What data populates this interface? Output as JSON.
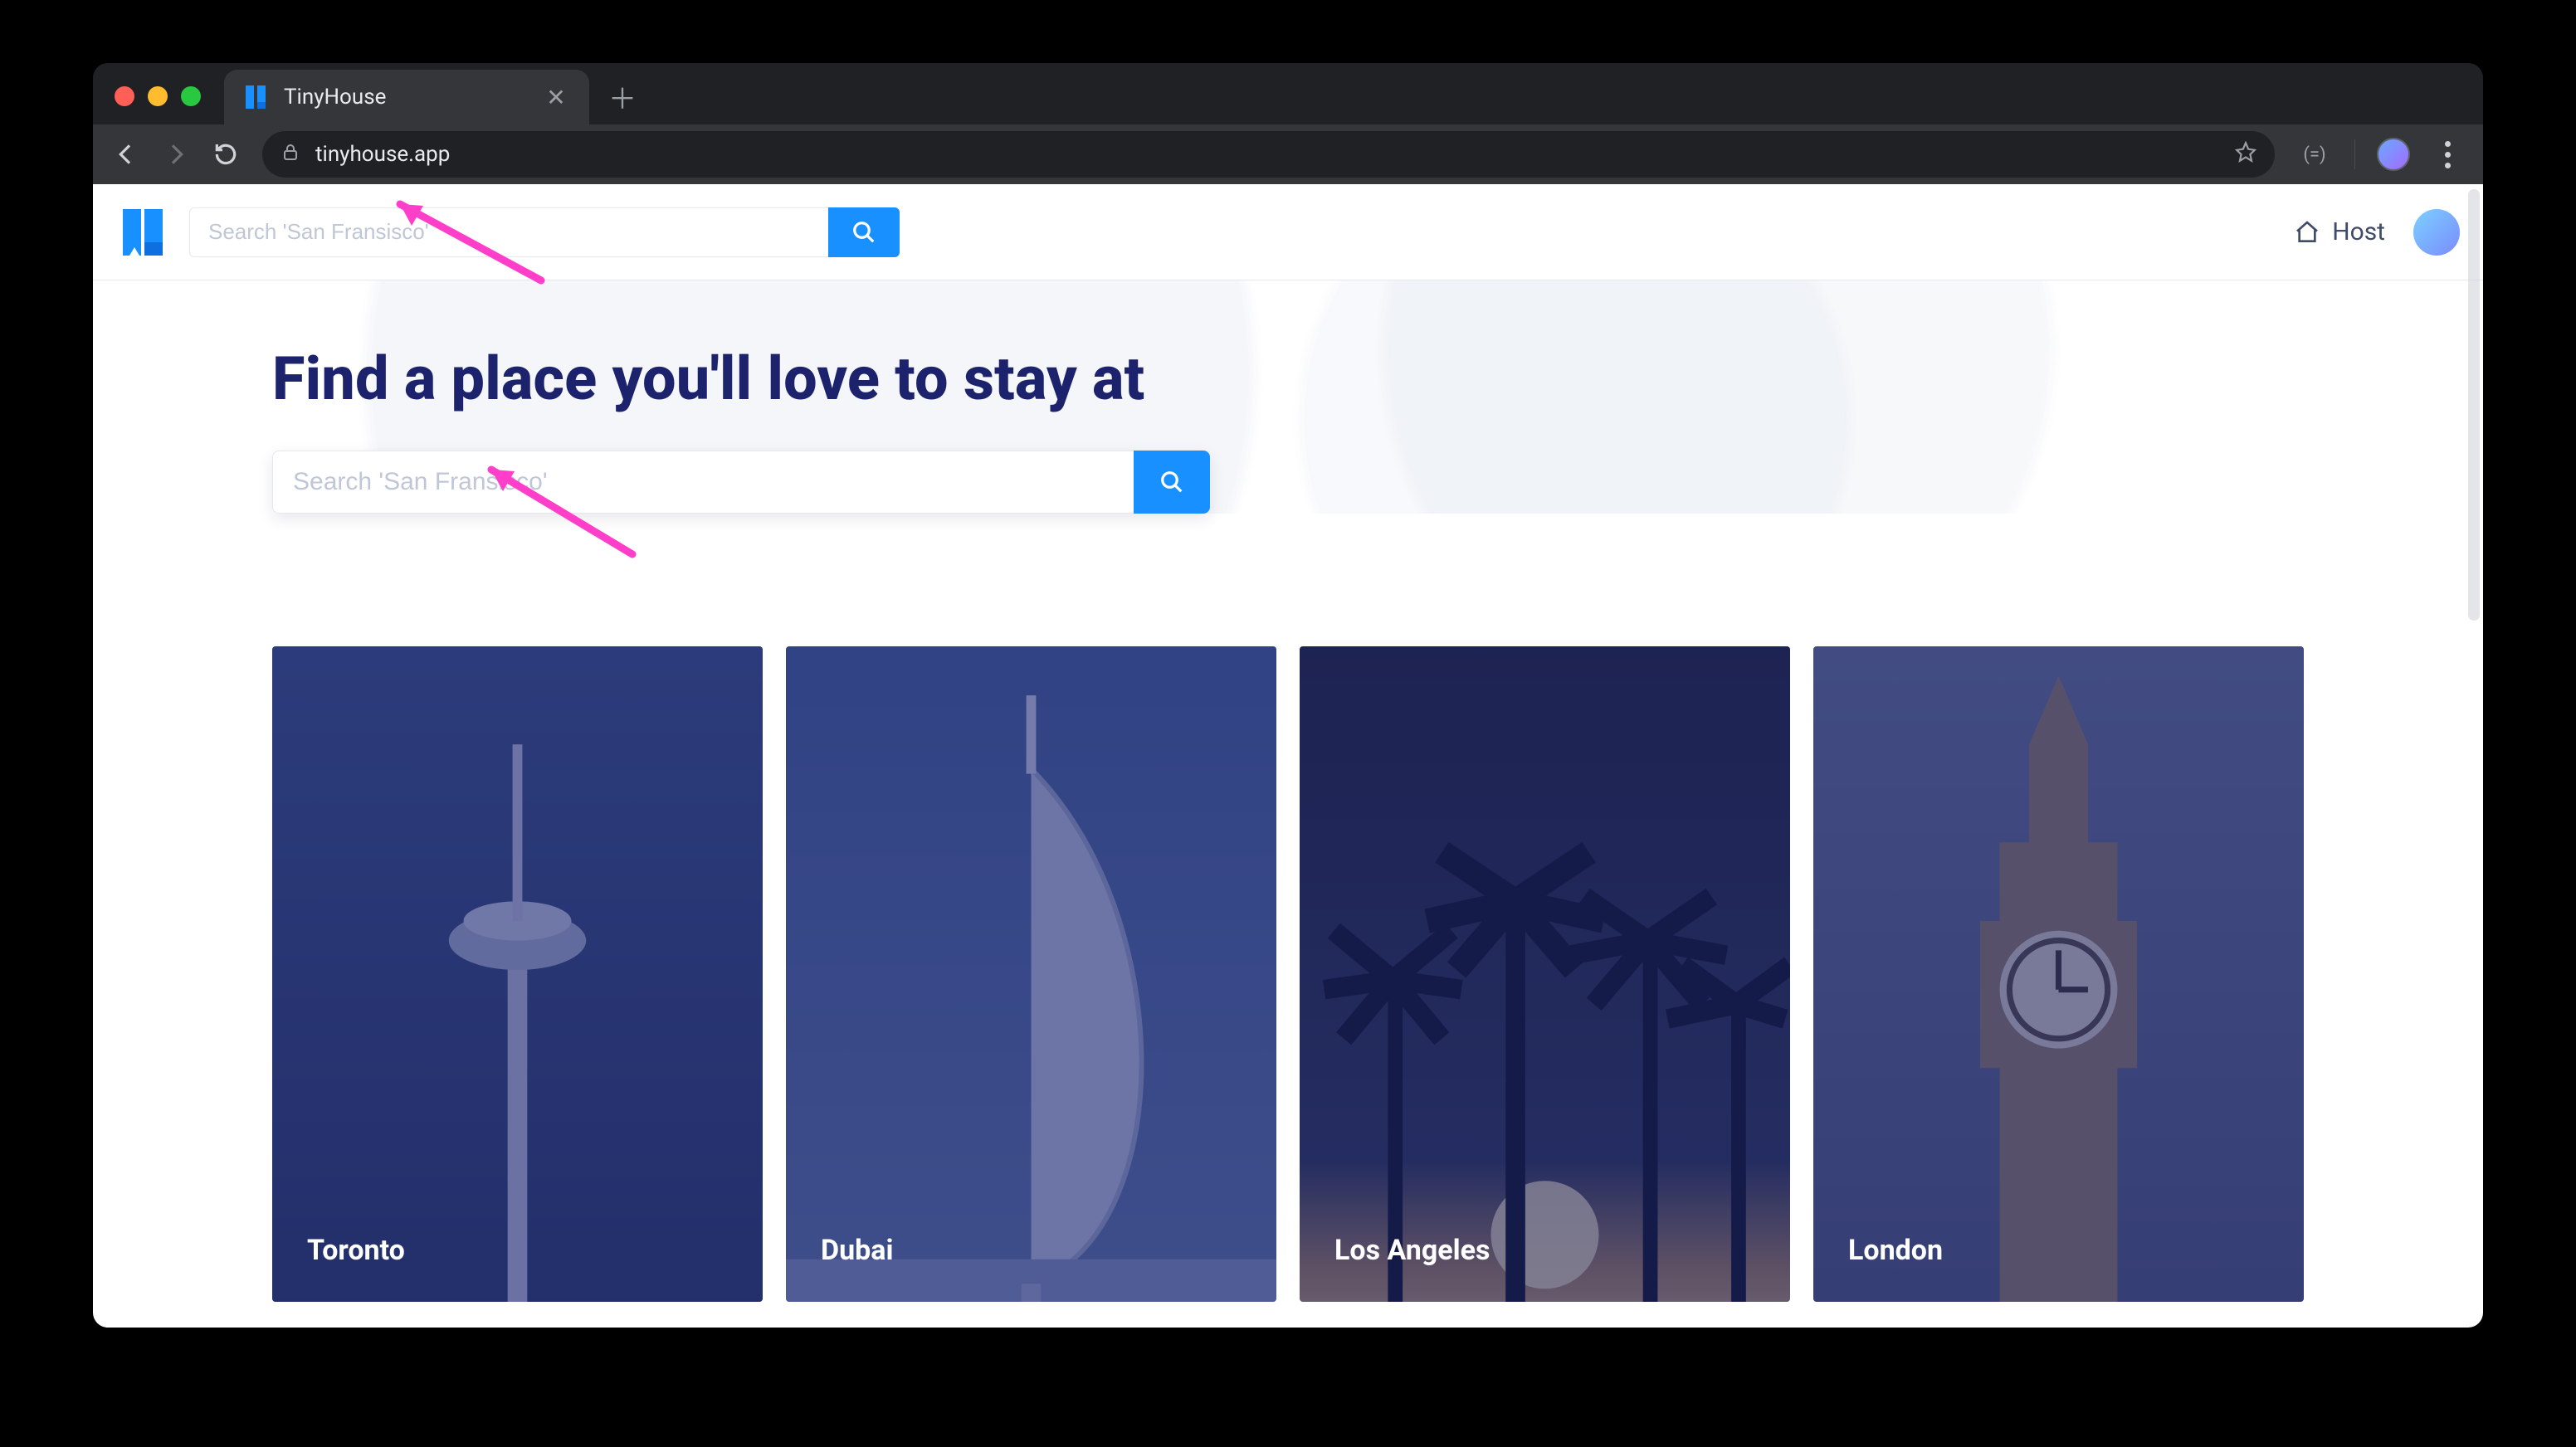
{
  "browser": {
    "tab_title": "TinyHouse",
    "url": "tinyhouse.app"
  },
  "header": {
    "search_placeholder": "Search 'San Fransisco'",
    "host_label": "Host"
  },
  "hero": {
    "title": "Find a place you'll love to stay at",
    "search_placeholder": "Search 'San Fransisco'"
  },
  "cities": [
    {
      "name": "Toronto"
    },
    {
      "name": "Dubai"
    },
    {
      "name": "Los Angeles"
    },
    {
      "name": "London"
    }
  ],
  "colors": {
    "accent": "#1890ff",
    "navy": "#1d226c",
    "arrow": "#ff3ec9"
  }
}
